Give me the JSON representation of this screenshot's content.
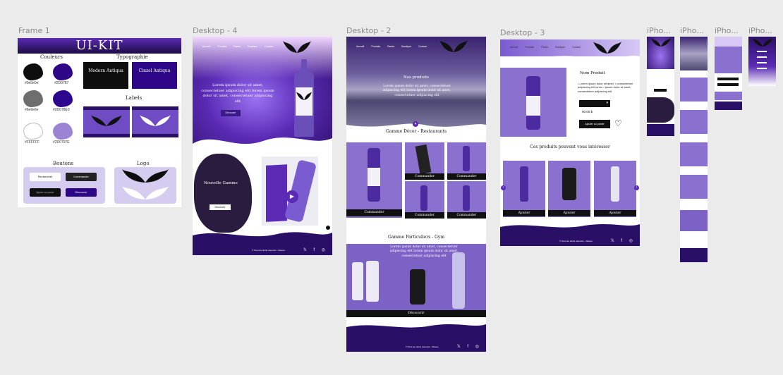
{
  "frames": {
    "frame1": "Frame 1",
    "desk4": "Desktop - 4",
    "desk2": "Desktop - 2",
    "desk3": "Desktop - 3",
    "ip1": "iPho...",
    "ip2": "iPho...",
    "ip3": "iPho...",
    "ip4": "iPho..."
  },
  "kit": {
    "title": "UI-KIT",
    "colors_title": "Couleurs",
    "typo_title": "Typographie",
    "labels_title": "Labels",
    "buttons_title": "Boutons",
    "logo_title": "Logo",
    "colors": [
      {
        "hex": "#0e0e0e",
        "label": "#0e0e0e"
      },
      {
        "hex": "#2d0787",
        "label": "#2D0787"
      },
      {
        "hex": "#6e6e6e",
        "label": "#6e6e6e"
      },
      {
        "hex": "#2d078e",
        "label": "#2D078E3"
      },
      {
        "hex": "#ffffff",
        "label": "#FFFFFF"
      },
      {
        "hex": "#9c84d4",
        "label": "#2D0797E"
      }
    ],
    "font1": "Modern Antiqua",
    "font2": "Cinzel Antiqua",
    "btn1": "Rechercher",
    "btn2": "Commander",
    "btn3": "Ajouter au panier",
    "btn4": "Découvrir"
  },
  "desk4": {
    "nav": [
      "Accueil",
      "Produits",
      "Panier",
      "Boutique",
      "Contact"
    ],
    "hero_text": "Lorem ipsum dolor sit amet, consectetuer adipiscing elit lorem ipsum dolor sit amet, consectetuer adipiscing elit",
    "hero_btn": "Découvrir",
    "new_title": "Nouvelle Gamme",
    "new_btn": "Découvrir",
    "copy": "© Tous les droits réservés - Oiseau"
  },
  "desk2": {
    "nav": [
      "Accueil",
      "Produits",
      "Panier",
      "Boutique",
      "Contact"
    ],
    "hero_title": "Nos produits",
    "hero_text": "Lorem ipsum dolor sit amet, consectetuer adipiscing elit lorem ipsum dolor sit amet, consectetuer adipiscing elit",
    "sect1": "Gamme Décor - Restaurants",
    "cmd": "Commander",
    "sect2": "Gamme Particuliers - Gym",
    "gym_text": "Lorem ipsum dolor sit amet, consectetuer adipiscing elit lorem ipsum dolor sit amet, consectetuer adipiscing elit",
    "gym_btn": "Découvrir",
    "copy": "© Tous les droits réservés - Oiseau"
  },
  "desk3": {
    "nav": [
      "Accueil",
      "Produits",
      "Panier",
      "Boutique",
      "Contact"
    ],
    "prod_title": "Nom Produit",
    "prod_bullets": "• Lorem ipsum dolor sit amet, • consectetuer adipiscing elit lorem • ipsum dolor sit amet, consectetuer adipiscing elit",
    "price": "00.00 $",
    "add_cart": "Ajouter au panier",
    "reco_title": "Ces produits peuvent vous intéresser",
    "add": "Ajouter",
    "copy": "© Tous les droits réservés - Oiseau"
  },
  "colors": {
    "purple_dark": "#2a0f66",
    "purple_mid": "#5b2bb5",
    "purple_light": "#8a70cf",
    "lavender": "#d6ccef"
  }
}
